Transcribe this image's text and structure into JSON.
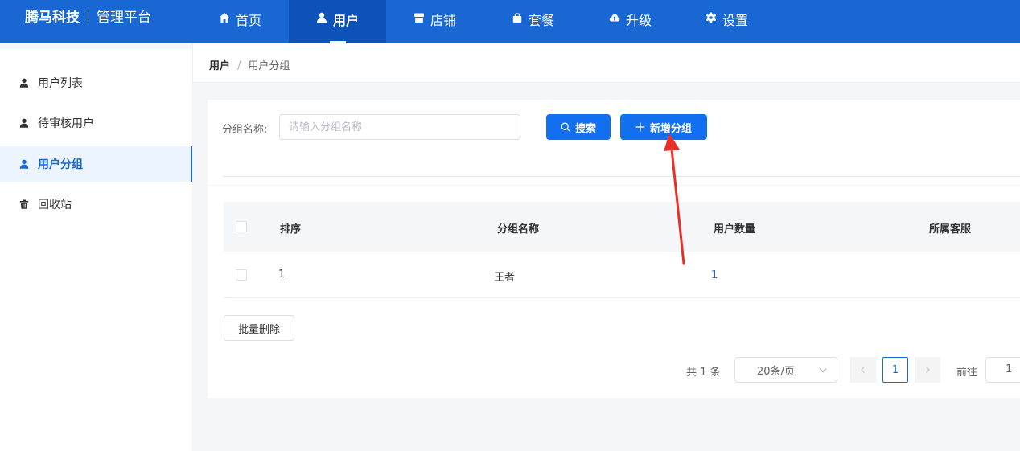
{
  "app": {
    "brand": "腾马科技",
    "subtitle": "管理平台"
  },
  "nav": [
    {
      "label": "首页",
      "icon": "home-icon"
    },
    {
      "label": "用户",
      "icon": "user-icon",
      "active": true
    },
    {
      "label": "店铺",
      "icon": "store-icon"
    },
    {
      "label": "套餐",
      "icon": "shopping-bag-icon"
    },
    {
      "label": "升级",
      "icon": "cloud-upload-icon"
    },
    {
      "label": "设置",
      "icon": "gear-icon"
    }
  ],
  "sidebar": {
    "items": [
      {
        "label": "用户列表",
        "icon": "user-icon"
      },
      {
        "label": "待审核用户",
        "icon": "user-icon"
      },
      {
        "label": "用户分组",
        "icon": "user-icon",
        "active": true
      },
      {
        "label": "回收站",
        "icon": "trash-icon"
      }
    ]
  },
  "breadcrumb": {
    "root": "用户",
    "separator": "/",
    "current": "用户分组"
  },
  "search": {
    "label": "分组名称:",
    "placeholder": "请输入分组名称",
    "value": "",
    "search_button": "搜索",
    "add_button": "新增分组"
  },
  "table": {
    "columns": [
      "排序",
      "分组名称",
      "用户数量",
      "所属客服"
    ],
    "rows": [
      {
        "order": "1",
        "name": "王者",
        "count": "1",
        "service": ""
      }
    ]
  },
  "batch_delete": "批量删除",
  "pagination": {
    "total_text": "共 1 条",
    "page_size": "20条/页",
    "current_page": "1",
    "goto_label": "前往",
    "goto_value": "1"
  },
  "colors": {
    "primary": "#1967d2",
    "button": "#1270f0",
    "annotation_arrow": "#e8302a"
  }
}
